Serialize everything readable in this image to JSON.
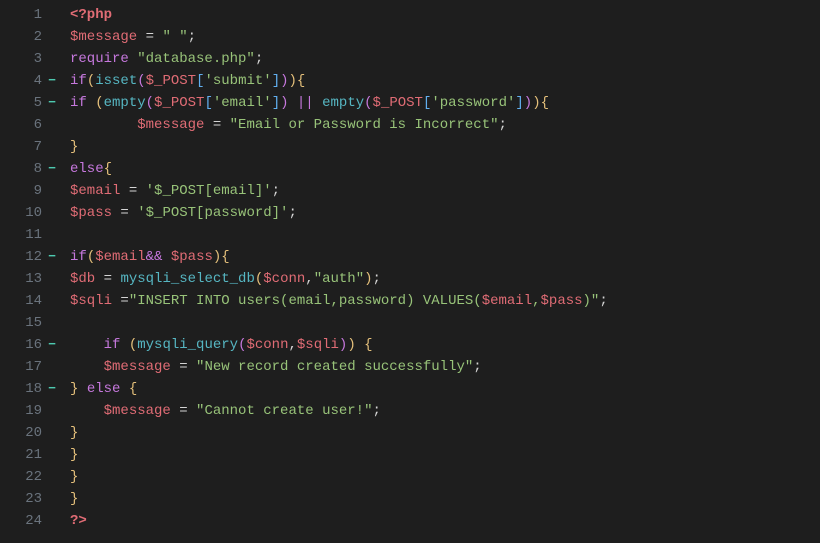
{
  "fold_marker": "−",
  "lines": [
    {
      "n": "1",
      "fold": false,
      "tokens": [
        [
          "tk-tag",
          "<?php"
        ]
      ]
    },
    {
      "n": "2",
      "fold": false,
      "tokens": [
        [
          "tk-var",
          "$message"
        ],
        [
          "tk-punc",
          " = "
        ],
        [
          "tk-str",
          "\" \""
        ],
        [
          "tk-punc",
          ";"
        ]
      ]
    },
    {
      "n": "3",
      "fold": false,
      "tokens": [
        [
          "tk-kw",
          "require"
        ],
        [
          "tk-punc",
          " "
        ],
        [
          "tk-str",
          "\"database.php\""
        ],
        [
          "tk-punc",
          ";"
        ]
      ]
    },
    {
      "n": "4",
      "fold": true,
      "tokens": [
        [
          "tk-kw",
          "if"
        ],
        [
          "tk-gold",
          "("
        ],
        [
          "tk-builtin",
          "isset"
        ],
        [
          "tk-purple",
          "("
        ],
        [
          "tk-var",
          "$_POST"
        ],
        [
          "tk-blue",
          "["
        ],
        [
          "tk-str",
          "'submit'"
        ],
        [
          "tk-blue",
          "]"
        ],
        [
          "tk-purple",
          ")"
        ],
        [
          "tk-gold",
          "){"
        ]
      ]
    },
    {
      "n": "5",
      "fold": true,
      "tokens": [
        [
          "tk-kw",
          "if"
        ],
        [
          "tk-punc",
          " "
        ],
        [
          "tk-gold",
          "("
        ],
        [
          "tk-builtin",
          "empty"
        ],
        [
          "tk-purple",
          "("
        ],
        [
          "tk-var",
          "$_POST"
        ],
        [
          "tk-blue",
          "["
        ],
        [
          "tk-str",
          "'email'"
        ],
        [
          "tk-blue",
          "]"
        ],
        [
          "tk-purple",
          ")"
        ],
        [
          "tk-punc",
          " "
        ],
        [
          "tk-kw",
          "||"
        ],
        [
          "tk-punc",
          " "
        ],
        [
          "tk-builtin",
          "empty"
        ],
        [
          "tk-purple",
          "("
        ],
        [
          "tk-var",
          "$_POST"
        ],
        [
          "tk-blue",
          "["
        ],
        [
          "tk-str",
          "'password'"
        ],
        [
          "tk-blue",
          "]"
        ],
        [
          "tk-purple",
          ")"
        ],
        [
          "tk-gold",
          "){"
        ]
      ]
    },
    {
      "n": "6",
      "fold": false,
      "tokens": [
        [
          "tk-punc",
          "        "
        ],
        [
          "tk-var",
          "$message"
        ],
        [
          "tk-punc",
          " = "
        ],
        [
          "tk-str",
          "\"Email or Password is Incorrect\""
        ],
        [
          "tk-punc",
          ";"
        ]
      ]
    },
    {
      "n": "7",
      "fold": false,
      "tokens": [
        [
          "tk-gold",
          "}"
        ]
      ]
    },
    {
      "n": "8",
      "fold": true,
      "tokens": [
        [
          "tk-kw",
          "else"
        ],
        [
          "tk-gold",
          "{"
        ]
      ]
    },
    {
      "n": "9",
      "fold": false,
      "tokens": [
        [
          "tk-var",
          "$email"
        ],
        [
          "tk-punc",
          " = "
        ],
        [
          "tk-str",
          "'$_POST[email]'"
        ],
        [
          "tk-punc",
          ";"
        ]
      ]
    },
    {
      "n": "10",
      "fold": false,
      "tokens": [
        [
          "tk-var",
          "$pass"
        ],
        [
          "tk-punc",
          " = "
        ],
        [
          "tk-str",
          "'$_POST[password]'"
        ],
        [
          "tk-punc",
          ";"
        ]
      ]
    },
    {
      "n": "11",
      "fold": false,
      "tokens": [
        [
          "tk-punc",
          ""
        ]
      ]
    },
    {
      "n": "12",
      "fold": true,
      "tokens": [
        [
          "tk-kw",
          "if"
        ],
        [
          "tk-gold",
          "("
        ],
        [
          "tk-var",
          "$email"
        ],
        [
          "tk-kw",
          "&&"
        ],
        [
          "tk-punc",
          " "
        ],
        [
          "tk-var",
          "$pass"
        ],
        [
          "tk-gold",
          "){"
        ]
      ]
    },
    {
      "n": "13",
      "fold": false,
      "tokens": [
        [
          "tk-var",
          "$db"
        ],
        [
          "tk-punc",
          " = "
        ],
        [
          "tk-builtin",
          "mysqli_select_db"
        ],
        [
          "tk-gold",
          "("
        ],
        [
          "tk-var",
          "$conn"
        ],
        [
          "tk-punc",
          ","
        ],
        [
          "tk-str",
          "\"auth\""
        ],
        [
          "tk-gold",
          ")"
        ],
        [
          "tk-punc",
          ";"
        ]
      ]
    },
    {
      "n": "14",
      "fold": false,
      "tokens": [
        [
          "tk-var",
          "$sqli"
        ],
        [
          "tk-punc",
          " ="
        ],
        [
          "tk-str",
          "\"INSERT INTO users(email,password) VALUES("
        ],
        [
          "tk-var",
          "$email"
        ],
        [
          "tk-str",
          ","
        ],
        [
          "tk-var",
          "$pass"
        ],
        [
          "tk-str",
          ")\""
        ],
        [
          "tk-punc",
          ";"
        ]
      ]
    },
    {
      "n": "15",
      "fold": false,
      "tokens": [
        [
          "tk-punc",
          ""
        ]
      ]
    },
    {
      "n": "16",
      "fold": true,
      "tokens": [
        [
          "tk-punc",
          "    "
        ],
        [
          "tk-kw",
          "if"
        ],
        [
          "tk-punc",
          " "
        ],
        [
          "tk-gold",
          "("
        ],
        [
          "tk-builtin",
          "mysqli_query"
        ],
        [
          "tk-purple",
          "("
        ],
        [
          "tk-var",
          "$conn"
        ],
        [
          "tk-punc",
          ","
        ],
        [
          "tk-var",
          "$sqli"
        ],
        [
          "tk-purple",
          ")"
        ],
        [
          "tk-gold",
          ") {"
        ]
      ]
    },
    {
      "n": "17",
      "fold": false,
      "tokens": [
        [
          "tk-punc",
          "    "
        ],
        [
          "tk-var",
          "$message"
        ],
        [
          "tk-punc",
          " = "
        ],
        [
          "tk-str",
          "\"New record created successfully\""
        ],
        [
          "tk-punc",
          ";"
        ]
      ]
    },
    {
      "n": "18",
      "fold": true,
      "tokens": [
        [
          "tk-gold",
          "}"
        ],
        [
          "tk-punc",
          " "
        ],
        [
          "tk-kw",
          "else"
        ],
        [
          "tk-punc",
          " "
        ],
        [
          "tk-gold",
          "{"
        ]
      ]
    },
    {
      "n": "19",
      "fold": false,
      "tokens": [
        [
          "tk-punc",
          "    "
        ],
        [
          "tk-var",
          "$message"
        ],
        [
          "tk-punc",
          " = "
        ],
        [
          "tk-str",
          "\"Cannot create user!\""
        ],
        [
          "tk-punc",
          ";"
        ]
      ]
    },
    {
      "n": "20",
      "fold": false,
      "tokens": [
        [
          "tk-gold",
          "}"
        ]
      ]
    },
    {
      "n": "21",
      "fold": false,
      "tokens": [
        [
          "tk-gold",
          "}"
        ]
      ]
    },
    {
      "n": "22",
      "fold": false,
      "tokens": [
        [
          "tk-gold",
          "}"
        ]
      ]
    },
    {
      "n": "23",
      "fold": false,
      "tokens": [
        [
          "tk-gold",
          "}"
        ]
      ]
    },
    {
      "n": "24",
      "fold": false,
      "tokens": [
        [
          "tk-tag",
          "?>"
        ]
      ]
    }
  ]
}
